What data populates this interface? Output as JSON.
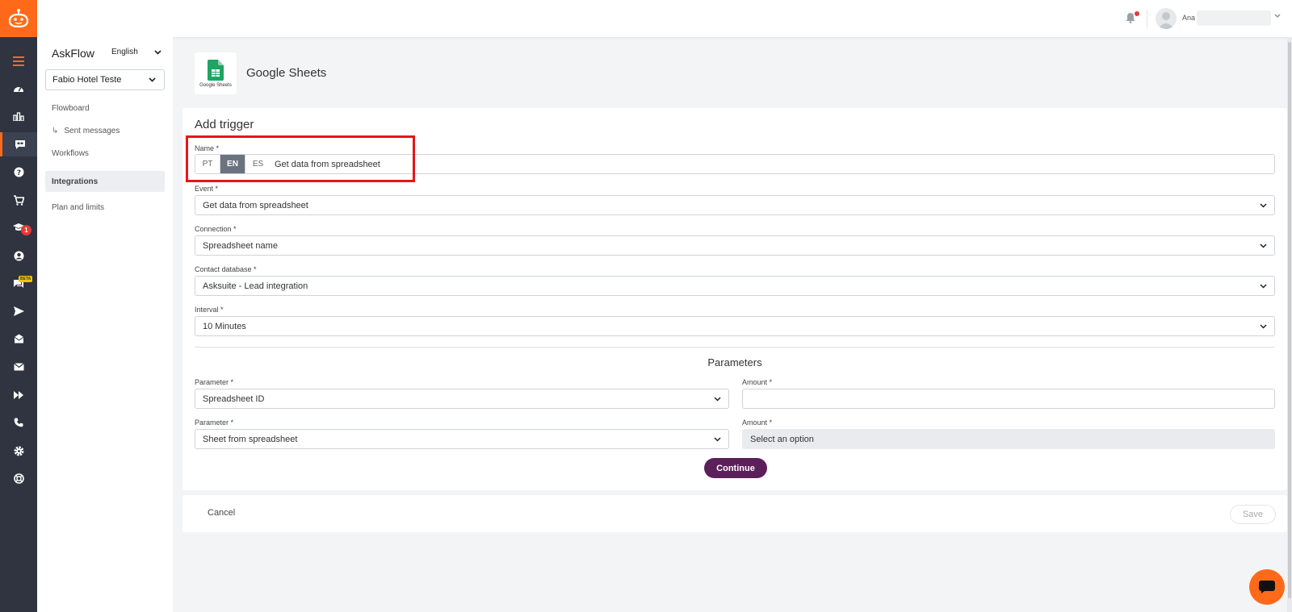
{
  "topbar": {
    "user_name": "Ana"
  },
  "subnav": {
    "brand": "AskFlow",
    "language": "English",
    "hotel": "Fabio Hotel Teste",
    "items": [
      {
        "label": "Flowboard"
      },
      {
        "label": "Sent messages"
      },
      {
        "label": "Workflows"
      },
      {
        "label": "Integrations"
      },
      {
        "label": "Plan and limits"
      }
    ],
    "sub_arrow": "↳"
  },
  "integration": {
    "title": "Google Sheets",
    "logo_text": "Google Sheets"
  },
  "form": {
    "title": "Add trigger",
    "name_label": "Name *",
    "langs": [
      "PT",
      "EN",
      "ES"
    ],
    "name_value": "Get data from spreadsheet",
    "event_label": "Event *",
    "event_value": "Get data from spreadsheet",
    "connection_label": "Connection *",
    "connection_value": "Spreadsheet name",
    "contact_db_label": "Contact database *",
    "contact_db_value": "Asksuite - Lead integration",
    "interval_label": "Interval *",
    "interval_value": "10 Minutes",
    "parameters_title": "Parameters",
    "params": [
      {
        "param_label": "Parameter *",
        "param_value": "Spreadsheet ID",
        "amount_label": "Amount *",
        "amount_value": ""
      },
      {
        "param_label": "Parameter *",
        "param_value": "Sheet from spreadsheet",
        "amount_label": "Amount *",
        "amount_placeholder": "Select an option"
      }
    ],
    "continue_label": "Continue"
  },
  "footer": {
    "cancel_label": "Cancel",
    "save_label": "Save"
  },
  "rail": {
    "badge_count": "1",
    "beta_label": "BETA"
  },
  "colors": {
    "brand_orange": "#ff6a1a",
    "rail_bg": "#2f3440",
    "primary_purple": "#5b1f59",
    "highlight_red": "#e8141a"
  }
}
